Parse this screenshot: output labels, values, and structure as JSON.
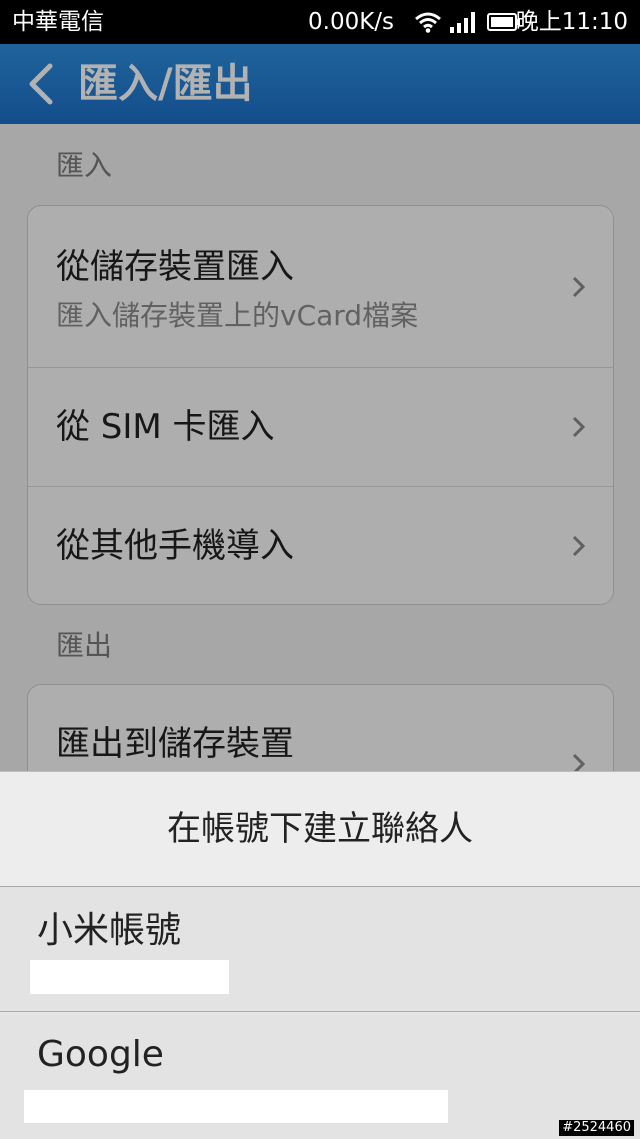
{
  "status_bar": {
    "carrier": "中華電信",
    "net_speed": "0.00K/s",
    "time": "晚上11:10"
  },
  "header": {
    "title": "匯入/匯出"
  },
  "import_section": {
    "header": "匯入",
    "items": [
      {
        "title": "從儲存裝置匯入",
        "subtitle": "匯入儲存裝置上的vCard檔案"
      },
      {
        "title": "從 SIM 卡匯入"
      },
      {
        "title": "從其他手機導入"
      }
    ]
  },
  "export_section": {
    "header": "匯出",
    "items": [
      {
        "title": "匯出到儲存裝置"
      }
    ]
  },
  "account_sheet": {
    "title": "在帳號下建立聯絡人",
    "accounts": [
      {
        "name": "小米帳號"
      },
      {
        "name": "Google"
      }
    ]
  },
  "watermark": "#2524460",
  "colors": {
    "action_bar": "#1b6fc7",
    "status_bar": "#000000",
    "sheet_background": "#e8e8e8"
  }
}
